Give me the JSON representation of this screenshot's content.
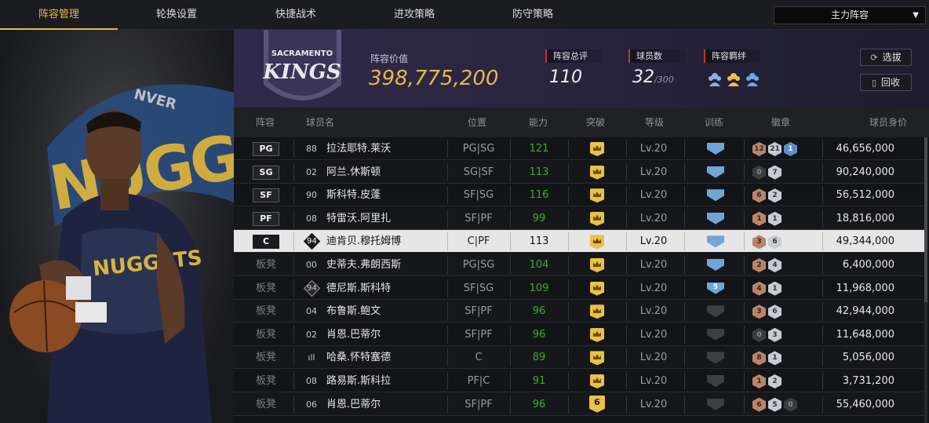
{
  "tabs": [
    {
      "label": "阵容管理",
      "active": true
    },
    {
      "label": "轮换设置",
      "active": false
    },
    {
      "label": "快捷战术",
      "active": false
    },
    {
      "label": "进攻策略",
      "active": false
    },
    {
      "label": "防守策略",
      "active": false
    }
  ],
  "lineup_select": {
    "value": "主力阵容"
  },
  "team_logo_text": [
    "SACRAMENTO",
    "KINGS"
  ],
  "summary": {
    "value_label": "阵容价值",
    "value": "398,775,200",
    "rating_label": "阵容总评",
    "rating": "110",
    "count_label": "球员数",
    "count": "32",
    "count_max": "/300",
    "bond_label": "阵容羁绊",
    "select_button": "选拔",
    "recycle_button": "回收"
  },
  "columns": [
    "阵容",
    "球员名",
    "位置",
    "能力",
    "突破",
    "等级",
    "训练",
    "徽章",
    "球员身价"
  ],
  "rows": [
    {
      "slot": "PG",
      "starter": true,
      "jersey": "88",
      "name": "拉法耶特.莱沃",
      "pos": "PG|SG",
      "ability": "121",
      "ability_color": "green",
      "level": "Lv.20",
      "train": "blue",
      "badges": [
        {
          "t": "bronze",
          "n": "12"
        },
        {
          "t": "silver",
          "n": "21"
        },
        {
          "t": "blue",
          "n": "1"
        }
      ],
      "value": "46,656,000"
    },
    {
      "slot": "SG",
      "starter": true,
      "jersey": "02",
      "name": "阿兰.休斯顿",
      "pos": "SG|SF",
      "ability": "113",
      "ability_color": "green",
      "level": "Lv.20",
      "train": "blue",
      "badges": [
        {
          "t": "dark",
          "n": "0"
        },
        {
          "t": "silver",
          "n": "7"
        }
      ],
      "value": "90,240,000"
    },
    {
      "slot": "SF",
      "starter": true,
      "jersey": "90",
      "name": "斯科特.皮蓬",
      "pos": "SF|SG",
      "ability": "116",
      "ability_color": "green",
      "level": "Lv.20",
      "train": "blue",
      "badges": [
        {
          "t": "bronze",
          "n": "6"
        },
        {
          "t": "silver",
          "n": "2"
        }
      ],
      "value": "56,512,000"
    },
    {
      "slot": "PF",
      "starter": true,
      "jersey": "08",
      "name": "特雷沃.阿里扎",
      "pos": "SF|PF",
      "ability": "99",
      "ability_color": "green",
      "level": "Lv.20",
      "train": "blue",
      "badges": [
        {
          "t": "bronze",
          "n": "1"
        },
        {
          "t": "silver",
          "n": "1"
        }
      ],
      "value": "18,816,000"
    },
    {
      "slot": "C",
      "starter": true,
      "selected": true,
      "jersey": "94",
      "jersey_diamond": true,
      "name": "迪肯贝.穆托姆博",
      "pos": "C|PF",
      "ability": "113",
      "ability_color": "white",
      "level": "Lv.20",
      "train": "blue",
      "badges": [
        {
          "t": "bronze",
          "n": "3"
        },
        {
          "t": "silver",
          "n": "6"
        }
      ],
      "value": "49,344,000"
    },
    {
      "slot": "板凳",
      "starter": false,
      "jersey": "00",
      "name": "史蒂夫.弗朗西斯",
      "pos": "PG|SG",
      "ability": "104",
      "ability_color": "green",
      "level": "Lv.20",
      "train": "blue",
      "badges": [
        {
          "t": "bronze",
          "n": "2"
        },
        {
          "t": "silver",
          "n": "4"
        }
      ],
      "value": "6,400,000"
    },
    {
      "slot": "板凳",
      "starter": false,
      "jersey": "94",
      "jersey_diamond": true,
      "name": "德尼斯.斯科特",
      "pos": "SF|SG",
      "ability": "109",
      "ability_color": "green",
      "level": "Lv.20",
      "train": "blue",
      "train_num": "5",
      "badges": [
        {
          "t": "bronze",
          "n": "4"
        },
        {
          "t": "silver",
          "n": "1"
        }
      ],
      "value": "11,968,000"
    },
    {
      "slot": "板凳",
      "starter": false,
      "jersey": "04",
      "name": "布鲁斯.鲍文",
      "pos": "SF|PF",
      "ability": "96",
      "ability_color": "green",
      "level": "Lv.20",
      "train": "gray",
      "badges": [
        {
          "t": "bronze",
          "n": "3"
        },
        {
          "t": "silver",
          "n": "6"
        }
      ],
      "value": "42,944,000"
    },
    {
      "slot": "板凳",
      "starter": false,
      "jersey": "02",
      "name": "肖恩.巴蒂尔",
      "pos": "SF|PF",
      "ability": "96",
      "ability_color": "green",
      "level": "Lv.20",
      "train": "gray",
      "badges": [
        {
          "t": "dark",
          "n": "0"
        },
        {
          "t": "silver",
          "n": "3"
        }
      ],
      "value": "11,648,000"
    },
    {
      "slot": "板凳",
      "starter": false,
      "jersey": "ıll",
      "name": "哈桑.怀特塞德",
      "pos": "C",
      "ability": "89",
      "ability_color": "green",
      "level": "Lv.20",
      "train": "gray",
      "badges": [
        {
          "t": "bronze",
          "n": "8"
        },
        {
          "t": "silver",
          "n": "1"
        }
      ],
      "value": "5,056,000"
    },
    {
      "slot": "板凳",
      "starter": false,
      "jersey": "08",
      "name": "路易斯.斯科拉",
      "pos": "PF|C",
      "ability": "91",
      "ability_color": "green",
      "level": "Lv.20",
      "train": "gray",
      "badges": [
        {
          "t": "bronze",
          "n": "1"
        },
        {
          "t": "silver",
          "n": "2"
        }
      ],
      "value": "3,731,200"
    },
    {
      "slot": "板凳",
      "starter": false,
      "jersey": "06",
      "name": "肖恩.巴蒂尔",
      "pos": "SF|PF",
      "ability": "96",
      "ability_color": "green",
      "level": "Lv.20",
      "train": "gray",
      "breakthrough_num": "6",
      "badges": [
        {
          "t": "bronze",
          "n": "6"
        },
        {
          "t": "silver",
          "n": "5"
        },
        {
          "t": "dark",
          "n": "0"
        }
      ],
      "value": "55,460,000"
    }
  ],
  "colors": {
    "accent": "#e8b84a",
    "ability_green": "#3fae2a",
    "summary_bg": "#2f2a4a"
  }
}
